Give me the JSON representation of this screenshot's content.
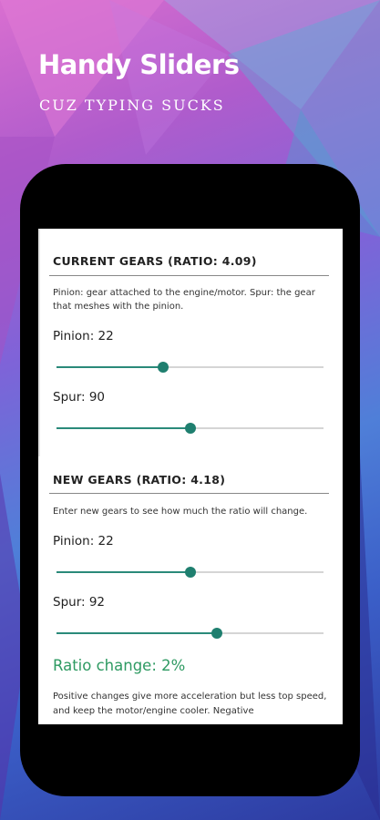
{
  "promo": {
    "title": "Handy Sliders",
    "subtitle": "CUZ TYPING SUCKS"
  },
  "current_gears": {
    "title": "CURRENT GEARS (RATIO: 4.09)",
    "description": "Pinion: gear attached to the engine/motor. Spur: the gear that meshes with the pinion.",
    "pinion_label": "Pinion: 22",
    "pinion_fraction": 0.4,
    "spur_label": "Spur: 90",
    "spur_fraction": 0.5
  },
  "new_gears": {
    "title": "NEW GEARS (RATIO: 4.18)",
    "description": "Enter new gears to see how much the ratio will change.",
    "pinion_label": "Pinion: 22",
    "pinion_fraction": 0.5,
    "spur_label": "Spur: 92",
    "spur_fraction": 0.6
  },
  "ratio_change": {
    "label": "Ratio change: 2%",
    "color": "#2e9a62"
  },
  "footer": {
    "text": "Positive changes give more acceleration but less top speed, and keep the motor/engine cooler.  Negative"
  },
  "colors": {
    "slider_accent": "#1f7f6f",
    "track": "#d5d5d5"
  }
}
